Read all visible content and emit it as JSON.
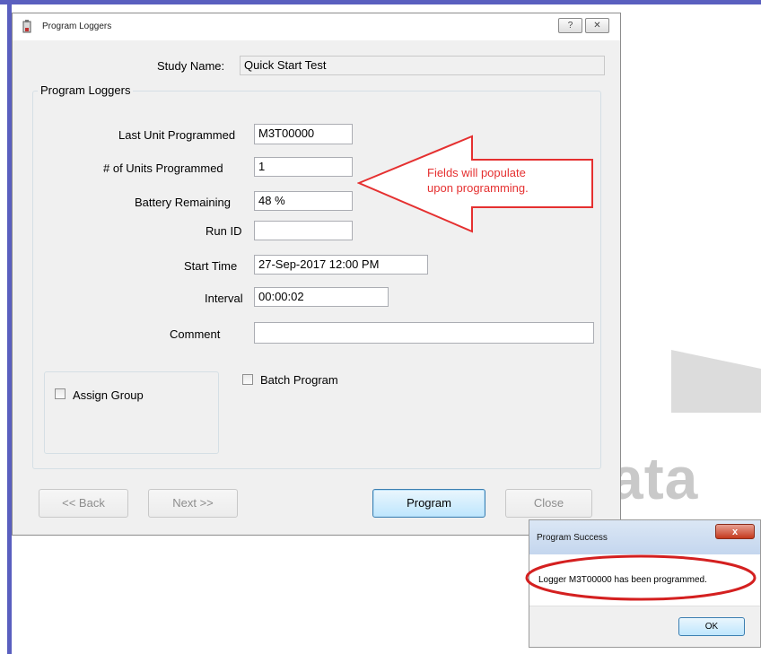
{
  "dialog": {
    "title": "Program Loggers",
    "help_label": "?",
    "close_label": "✕",
    "study_name_label": "Study Name:",
    "study_name_value": "Quick Start Test",
    "group_title": "Program Loggers",
    "fields": {
      "last_unit_label": "Last Unit Programmed",
      "last_unit_value": "M3T00000",
      "units_programmed_label": "# of Units Programmed",
      "units_programmed_value": "1",
      "battery_label": "Battery Remaining",
      "battery_value": "48 %",
      "run_id_label": "Run ID",
      "run_id_value": "",
      "start_time_label": "Start Time",
      "start_time_value": "27-Sep-2017 12:00 PM",
      "interval_label": "Interval",
      "interval_value": "00:00:02",
      "comment_label": "Comment",
      "comment_value": ""
    },
    "assign_group_label": "Assign Group",
    "batch_program_label": "Batch Program",
    "buttons": {
      "back": "<< Back",
      "next": "Next >>",
      "program": "Program",
      "close": "Close"
    }
  },
  "annotation": {
    "line1": "Fields will populate",
    "line2": "upon programming.",
    "color": "#e53030"
  },
  "popup": {
    "title": "Program Success",
    "close_label": "x",
    "message": "Logger M3T00000 has been programmed.",
    "ok_label": "OK"
  },
  "watermark": {
    "text": "ata"
  }
}
